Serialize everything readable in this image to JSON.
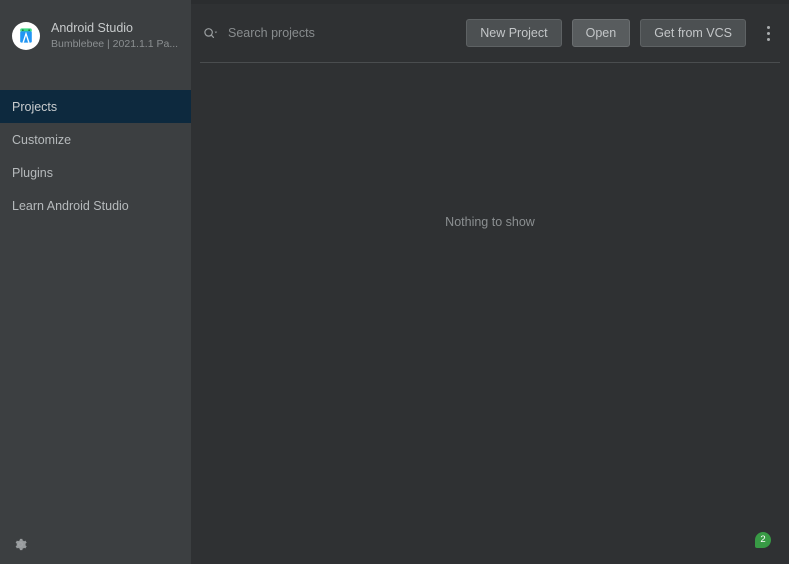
{
  "window": {
    "product_name": "Android Studio",
    "product_version": "Bumblebee | 2021.1.1 Pa..."
  },
  "sidebar": {
    "logo_icon": "android-studio-logo-icon",
    "items": [
      {
        "label": "Projects",
        "name": "sidebar-item-projects",
        "selected": true
      },
      {
        "label": "Customize",
        "name": "sidebar-item-customize",
        "selected": false
      },
      {
        "label": "Plugins",
        "name": "sidebar-item-plugins",
        "selected": false
      },
      {
        "label": "Learn Android Studio",
        "name": "sidebar-item-learn-android-studio",
        "selected": false
      }
    ],
    "settings_icon": "gear-icon"
  },
  "toolbar": {
    "search": {
      "icon": "search-icon",
      "placeholder": "Search projects",
      "value": ""
    },
    "new_project_label": "New Project",
    "open_label": "Open",
    "get_from_vcs_label": "Get from VCS",
    "more_icon": "kebab-menu-icon"
  },
  "main": {
    "empty_message": "Nothing to show"
  },
  "status": {
    "notification_count": "2"
  },
  "colors": {
    "sidebar_bg": "#3c3f41",
    "main_bg": "#2f3133",
    "selected_item_bg": "#0d293e",
    "button_bg": "#4c5052",
    "button_border": "#5e6264",
    "text_primary": "#c7cacb",
    "text_secondary": "#8b8f91",
    "notification_green": "#389a45"
  }
}
